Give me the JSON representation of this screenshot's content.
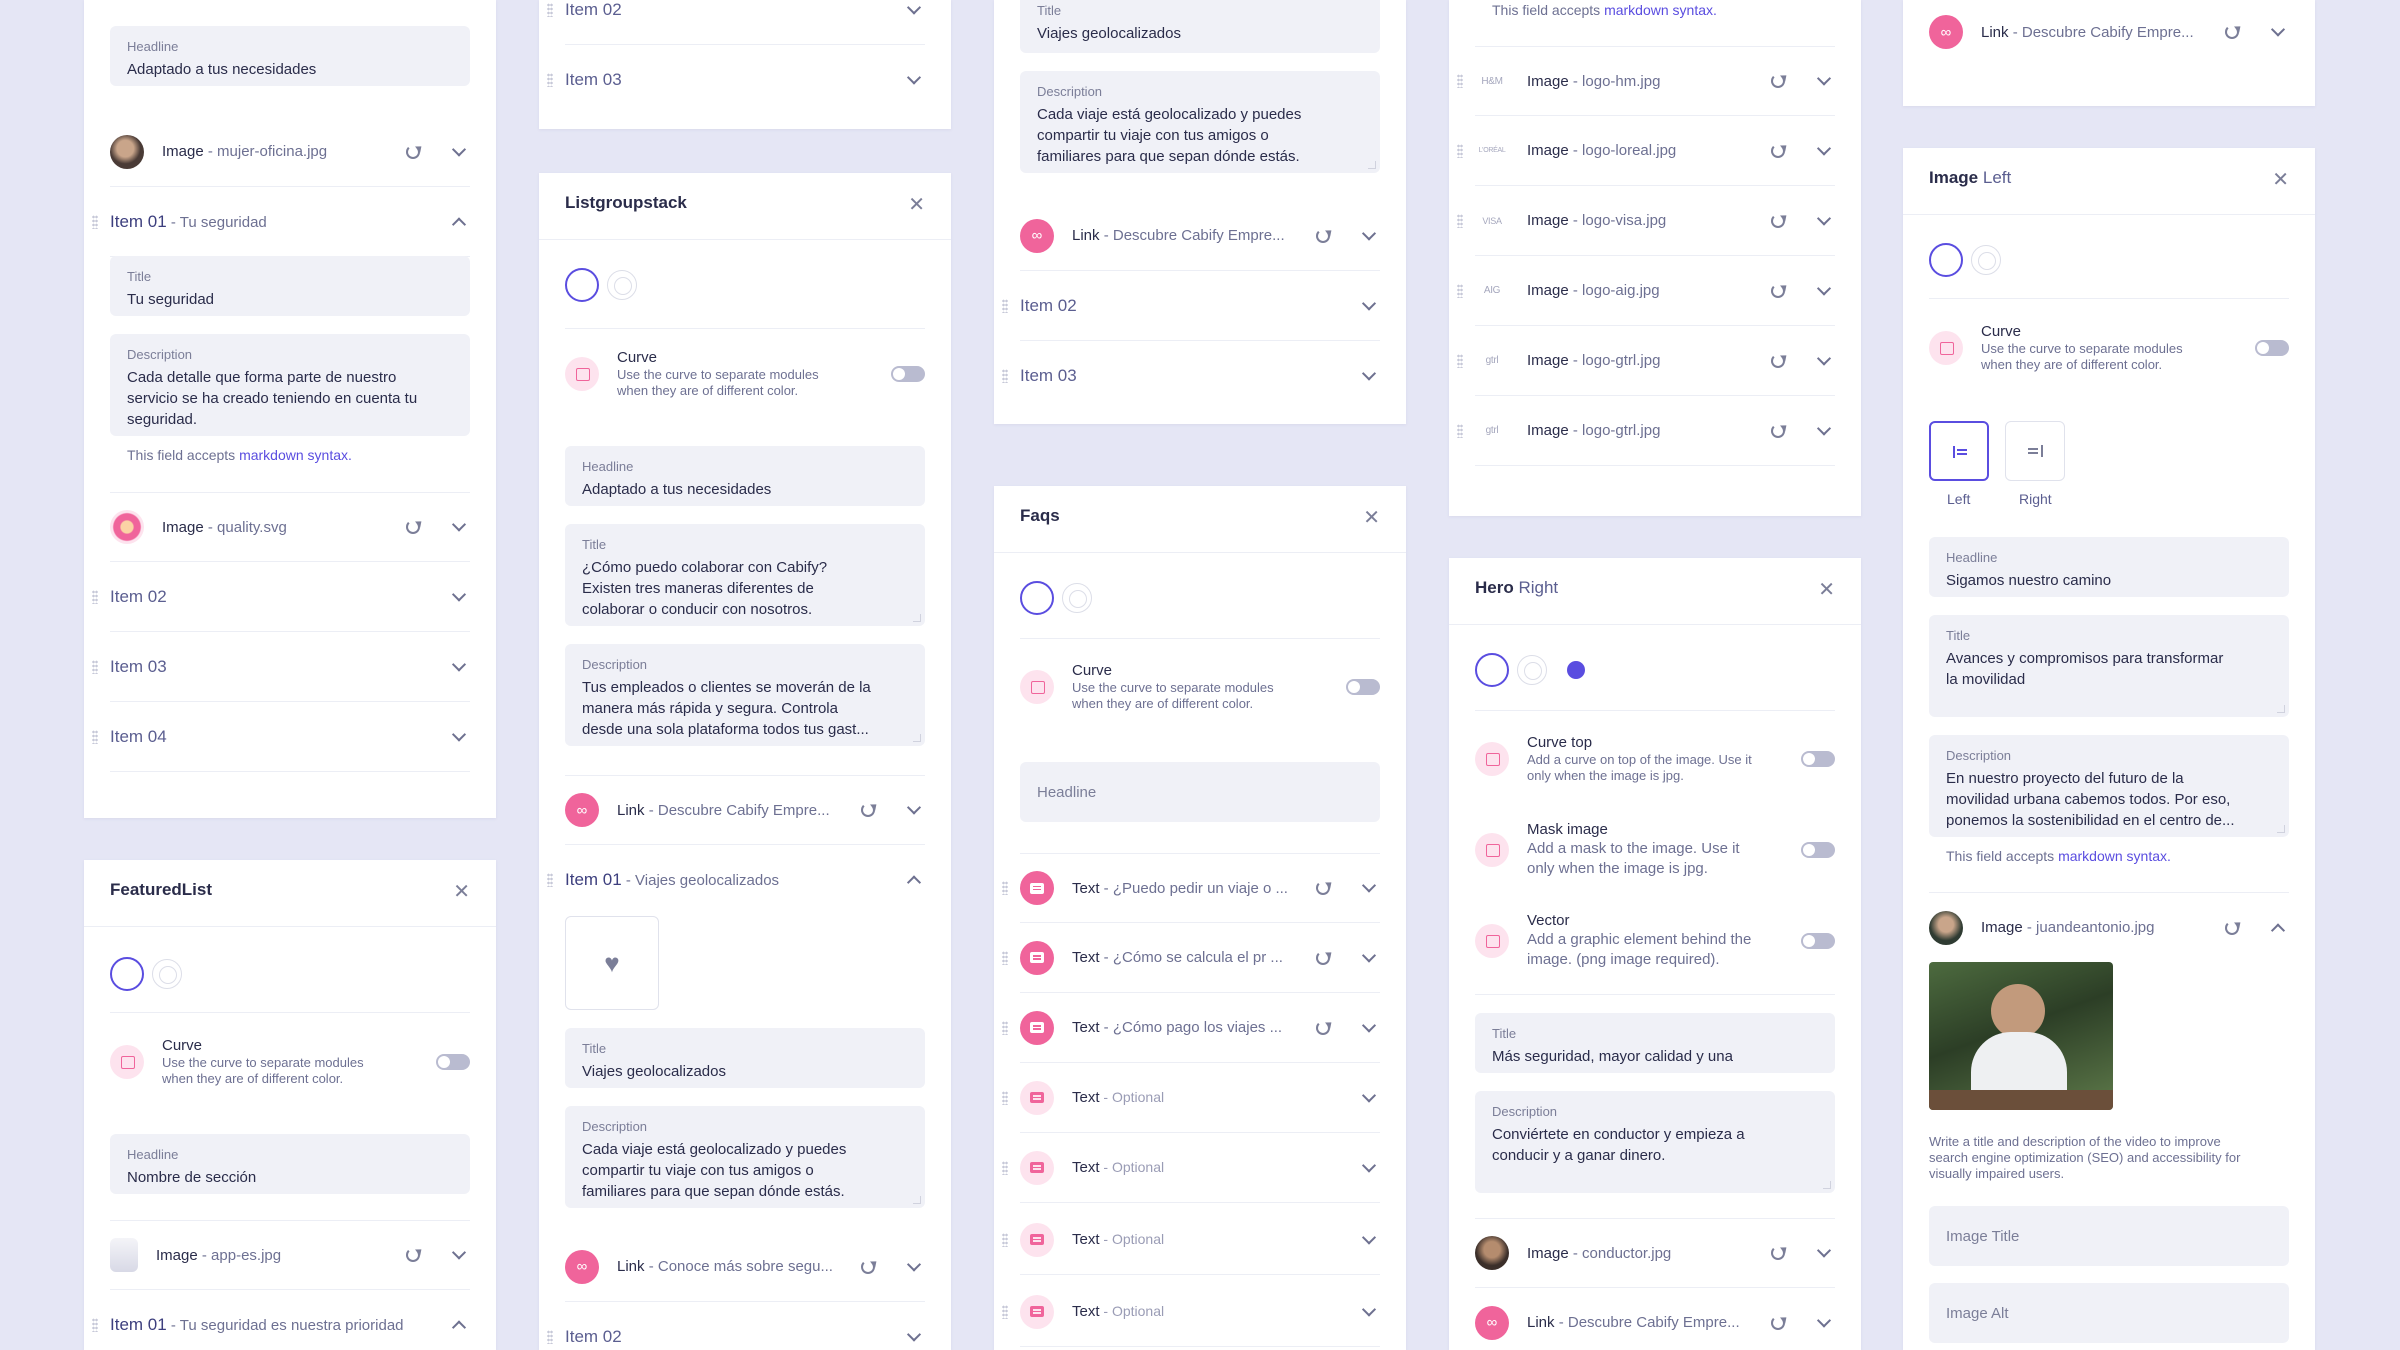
{
  "colors": {
    "accent": "#5a4de0",
    "pink": "#f0649b",
    "background": "#e5e6f5"
  },
  "common": {
    "curve_title": "Curve",
    "curve_desc_1": "Use the curve to separate modules",
    "curve_desc_2": "when they are of different color.",
    "md_prefix": "This field accepts",
    "md_link": "markdown syntax.",
    "headline": "Headline",
    "title": "Title",
    "description": "Description",
    "image": "Image",
    "link": "Link",
    "text": "Text",
    "optional": "Optional",
    "sep": " - "
  },
  "col1": {
    "top": {
      "headline_value": "Adaptado a tus necesidades",
      "image_file": "mujer-oficina.jpg",
      "item01_label": "Item 01",
      "item01_sub": "Tu seguridad",
      "title_value": "Tu seguridad",
      "desc_lines": [
        "Cada detalle que forma parte de nuestro",
        "servicio se ha creado teniendo en cuenta tu",
        "seguridad."
      ],
      "image2_file": "quality.svg",
      "items": [
        "Item 02",
        "Item 03",
        "Item 04"
      ]
    },
    "featured": {
      "title": "FeaturedList",
      "headline_value": "Nombre de sección",
      "image_file": "app-es.jpg",
      "item01_label": "Item 01",
      "item01_sub": "Tu seguridad es nuestra prioridad"
    }
  },
  "col2": {
    "top": {
      "items": [
        "Item 02",
        "Item 03"
      ]
    },
    "listgroup": {
      "title": "Listgroupstack",
      "headline_value": "Adaptado a tus necesidades",
      "title_lines": [
        "¿Cómo puedo colaborar con Cabify?",
        "Existen tres maneras diferentes de",
        "colaborar o conducir con nosotros."
      ],
      "desc_lines": [
        "Tus empleados o clientes se moverán de la",
        "manera más rápida y segura. Controla",
        "desde una sola plataforma todos tus gast..."
      ],
      "link1": "Descubre Cabify Empre...",
      "item01_label": "Item 01",
      "item01_sub": "Viajes geolocalizados",
      "item_title_value": "Viajes geolocalizados",
      "item_desc_lines": [
        "Cada viaje está geolocalizado y puedes",
        "compartir tu viaje con tus amigos o",
        "familiares para que sepan dónde estás."
      ],
      "link2": "Conoce más sobre segu...",
      "item02": "Item 02"
    }
  },
  "col3": {
    "top": {
      "title_value": "Viajes geolocalizados",
      "desc_lines": [
        "Cada viaje está geolocalizado y puedes",
        "compartir tu viaje con tus amigos o",
        "familiares para que sepan dónde estás."
      ],
      "link": "Descubre Cabify Empre...",
      "items": [
        "Item 02",
        "Item 03"
      ]
    },
    "faqs": {
      "title": "Faqs",
      "headline_placeholder": "Headline",
      "texts": [
        "¿Puedo pedir un viaje o ...",
        "¿Cómo se calcula el pr ...",
        "¿Cómo pago los viajes ..."
      ],
      "optional_count": 4
    }
  },
  "col4": {
    "top": {
      "md_note": "This field accepts",
      "logos": [
        {
          "mark": "H&M",
          "file": "logo-hm.jpg"
        },
        {
          "mark": "L'ORÉAL",
          "file": "logo-loreal.jpg"
        },
        {
          "mark": "VISA",
          "file": "logo-visa.jpg"
        },
        {
          "mark": "AIG",
          "file": "logo-aig.jpg"
        },
        {
          "mark": "gtrl",
          "file": "logo-gtrl.jpg"
        },
        {
          "mark": "gtrl",
          "file": "logo-gtrl.jpg"
        }
      ]
    },
    "hero": {
      "title": "Hero",
      "title_variant": "Right",
      "curve_top_title": "Curve top",
      "curve_top_desc": [
        "Add a curve on top of the image. Use it",
        "only when the image is jpg."
      ],
      "mask_title": "Mask image",
      "mask_desc": [
        "Add a mask to the image. Use it",
        "only when the image is jpg."
      ],
      "vector_title": "Vector",
      "vector_desc": [
        "Add a graphic element behind the",
        "image. (png image required)."
      ],
      "title_value": "Más seguridad, mayor calidad y una",
      "desc_lines": [
        "Conviértete en conductor y empieza a",
        "conducir y a ganar dinero."
      ],
      "image_file": "conductor.jpg",
      "link": "Descubre Cabify Empre..."
    }
  },
  "col5": {
    "top": {
      "link": "Descubre Cabify Empre..."
    },
    "imageleft": {
      "title": "Image",
      "title_variant": "Left",
      "left_label": "Left",
      "right_label": "Right",
      "headline_value": "Sigamos nuestro camino",
      "title_lines": [
        "Avances y compromisos para transformar",
        "la movilidad"
      ],
      "desc_lines": [
        "En nuestro proyecto del futuro de la",
        "movilidad urbana cabemos todos. Por eso,",
        "ponemos la sostenibilidad en el centro de..."
      ],
      "image_file": "juandeantonio.jpg",
      "seo_lines": [
        "Write a title and description of the video to improve",
        "search engine optimization (SEO) and accessibility for",
        "visually impaired users."
      ],
      "image_title_placeholder": "Image Title",
      "image_alt_placeholder": "Image Alt"
    }
  }
}
